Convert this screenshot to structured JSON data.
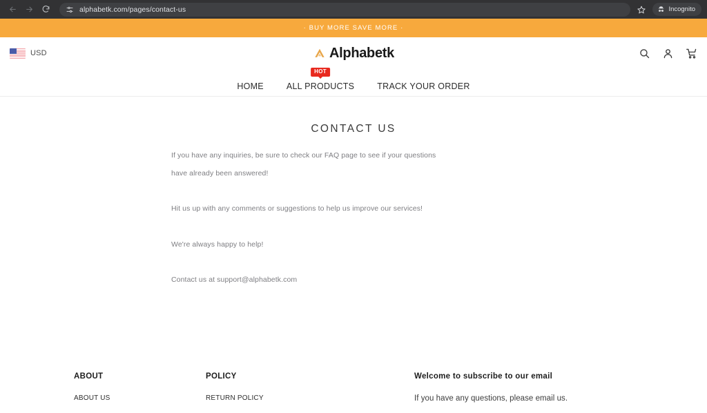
{
  "browser": {
    "back_icon": "arrow-left-icon",
    "forward_icon": "arrow-right-icon",
    "reload_icon": "reload-icon",
    "site_settings_icon": "tune-sliders-icon",
    "url": "alphabetk.com/pages/contact-us",
    "bookmark_icon": "star-icon",
    "incognito_label": "Incognito",
    "incognito_icon": "incognito-hat-icon"
  },
  "promo": {
    "text": "· BUY MORE SAVE MORE ·",
    "background": "#f7a93d",
    "color": "#ffffff"
  },
  "header": {
    "currency": {
      "flag_icon": "us-flag-icon",
      "label": "USD"
    },
    "brand": {
      "mark_icon": "alphabetk-triangle-logo-icon",
      "name": "Alphabetk",
      "mark_color": "#e8a64a"
    },
    "actions": [
      {
        "name": "search-icon"
      },
      {
        "name": "account-icon"
      },
      {
        "name": "cart-icon"
      }
    ]
  },
  "nav": {
    "items": [
      {
        "label": "HOME",
        "badge": null
      },
      {
        "label": "ALL PRODUCTS",
        "badge": "HOT"
      },
      {
        "label": "TRACK YOUR ORDER",
        "badge": null
      }
    ],
    "badge_color": "#e8291e"
  },
  "main": {
    "title": "CONTACT US",
    "paragraphs": [
      "If you have any inquiries, be sure to check our FAQ page to see if your questions",
      "have already been answered!",
      "Hit us up with any comments or suggestions to help us improve our services!",
      "We're always happy to help!",
      "Contact us at support@alphabetk.com"
    ]
  },
  "footer": {
    "columns": [
      {
        "heading": "ABOUT",
        "links": [
          "ABOUT US"
        ]
      },
      {
        "heading": "POLICY",
        "links": [
          "RETURN POLICY"
        ]
      }
    ],
    "newsletter": {
      "heading": "Welcome to subscribe to our email",
      "subtext": "If you have any questions, please email us."
    }
  }
}
